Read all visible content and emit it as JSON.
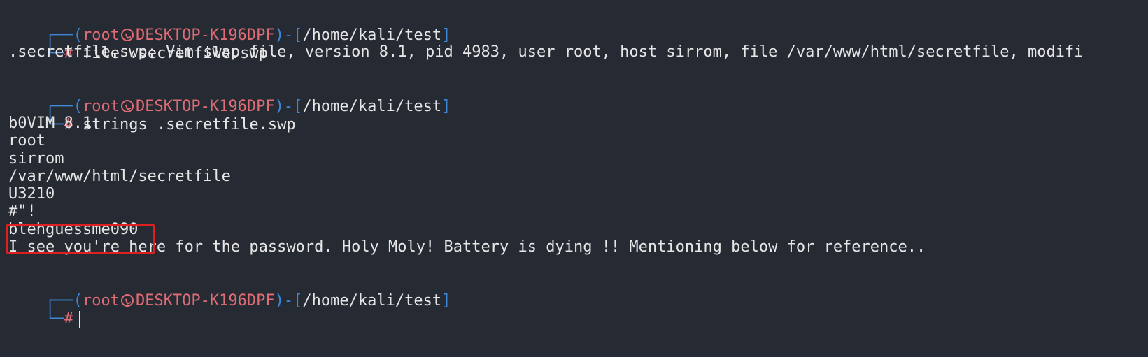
{
  "prompt_user": "root",
  "prompt_host": "DESKTOP-K196DPF",
  "prompt_path": "/home/kali/test",
  "prompt_symbol": "#",
  "commands": {
    "first": "file .secretfile.swp",
    "second": "strings .secretfile.swp"
  },
  "outputs": {
    "file_result": ".secretfile.swp: Vim swap file, version 8.1, pid 4983, user root, host sirrom, file /var/www/html/secretfile, modifi",
    "strings_lines": [
      "b0VIM 8.1",
      "root",
      "sirrom",
      "/var/www/html/secretfile",
      "U3210",
      "#\"!",
      "blehguessme090",
      "I see you're here for the password. Holy Moly! Battery is dying !! Mentioning below for reference.."
    ]
  },
  "highlight_color": "#e02020"
}
